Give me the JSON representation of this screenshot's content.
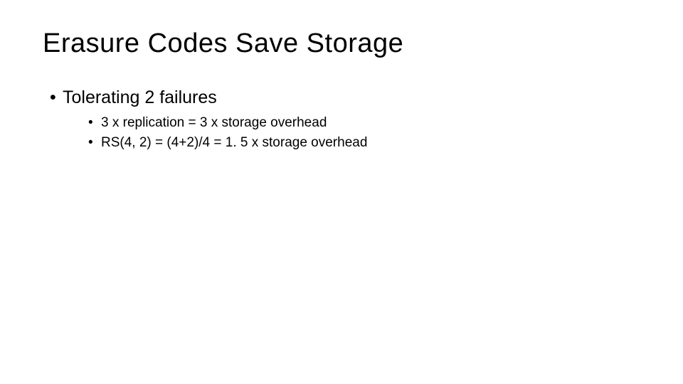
{
  "title": "Erasure Codes Save Storage",
  "bullets": {
    "item1": "Tolerating 2 failures",
    "sub1": "3 x replication = 3 x storage overhead",
    "sub2": "RS(4, 2) = (4+2)/4 = 1. 5 x storage overhead"
  }
}
